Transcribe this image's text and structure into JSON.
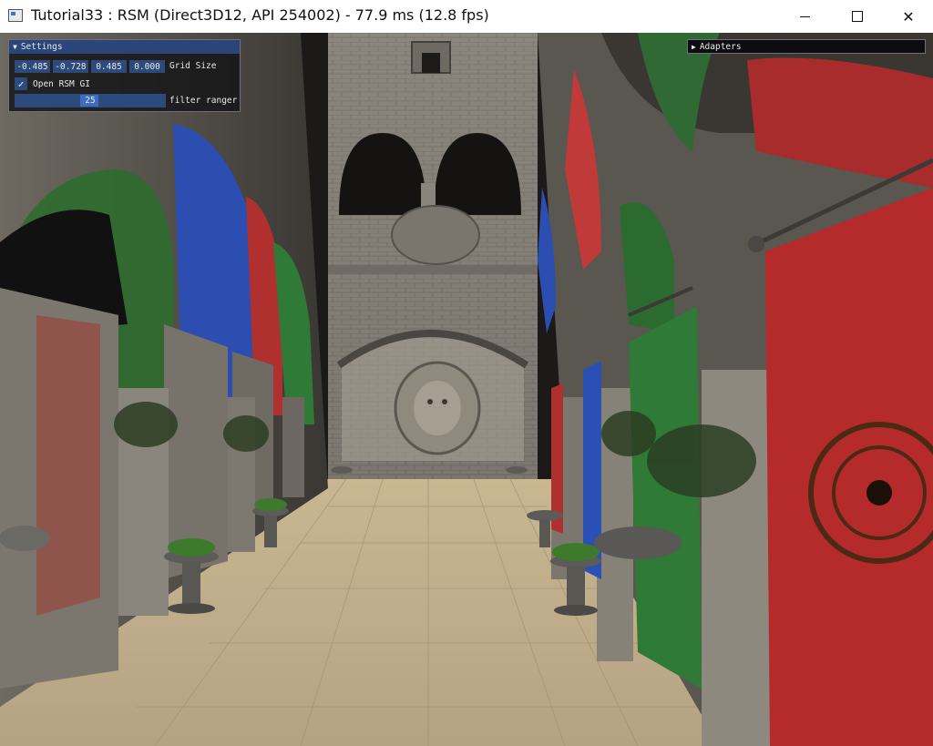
{
  "window": {
    "title": "Tutorial33 : RSM (Direct3D12, API 254002) - 77.9 ms (12.8 fps)",
    "icon": "app-window-icon",
    "controls": [
      "minimize",
      "maximize",
      "close"
    ]
  },
  "settings_panel": {
    "title": "Settings",
    "grid_values": [
      "-0.485",
      "-0.728",
      "0.485",
      "0.000"
    ],
    "grid_label": "Grid Size",
    "rsm_checkbox": {
      "label": "Open RSM GI",
      "checked": true
    },
    "filter_slider": {
      "value": "25",
      "label": "filter ranger"
    },
    "accent_color": "#29457a"
  },
  "adapters_panel": {
    "title": "Adapters",
    "collapsed": true
  },
  "scene": {
    "description_icon": "sponza-atrium-render",
    "banner_colors": [
      "#b52a2a",
      "#2a4fb5",
      "#2f7a36"
    ]
  }
}
